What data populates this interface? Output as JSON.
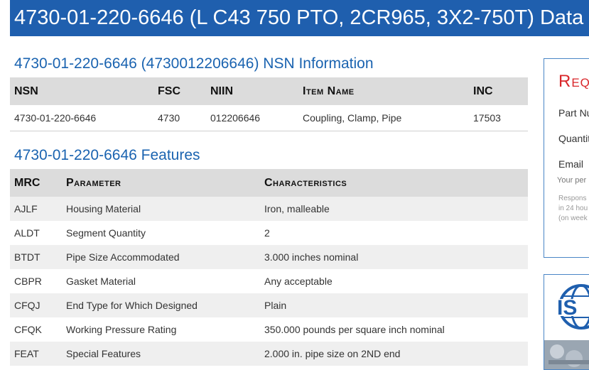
{
  "banner": {
    "title": "4730-01-220-6646 (L C43 750 PTO, 2CR965, 3X2-750T) Data"
  },
  "nsn_info": {
    "title": "4730-01-220-6646 (4730012206646) NSN Information",
    "headers": {
      "nsn": "NSN",
      "fsc": "FSC",
      "niin": "NIIN",
      "item_name": "Item Name",
      "inc": "INC"
    },
    "row": {
      "nsn": "4730-01-220-6646",
      "fsc": "4730",
      "niin": "012206646",
      "item_name": "Coupling, Clamp, Pipe",
      "inc": "17503"
    }
  },
  "features": {
    "title": "4730-01-220-6646 Features",
    "headers": {
      "mrc": "MRC",
      "parameter": "Parameter",
      "characteristics": "Characteristics"
    },
    "rows": [
      {
        "mrc": "AJLF",
        "parameter": "Housing Material",
        "value": "Iron, malleable"
      },
      {
        "mrc": "ALDT",
        "parameter": "Segment Quantity",
        "value": "2"
      },
      {
        "mrc": "BTDT",
        "parameter": "Pipe Size Accommodated",
        "value": "3.000 inches nominal"
      },
      {
        "mrc": "CBPR",
        "parameter": "Gasket Material",
        "value": "Any acceptable"
      },
      {
        "mrc": "CFQJ",
        "parameter": "End Type for Which Designed",
        "value": "Plain"
      },
      {
        "mrc": "CFQK",
        "parameter": "Working Pressure Rating",
        "value": "350.000 pounds per square inch nominal"
      },
      {
        "mrc": "FEAT",
        "parameter": "Special Features",
        "value": "2.000 in. pipe size on 2ND end"
      }
    ]
  },
  "side_form": {
    "heading": "Req",
    "part_number_label": "Part Nu",
    "quantity_label": "Quantit",
    "email_label": "Email",
    "email_hint": "Your per",
    "response_note": [
      "Respons",
      "in 24 hou",
      "(on week"
    ]
  },
  "iso": {
    "badge_text": "IS",
    "icon": "iso-globe-icon"
  }
}
